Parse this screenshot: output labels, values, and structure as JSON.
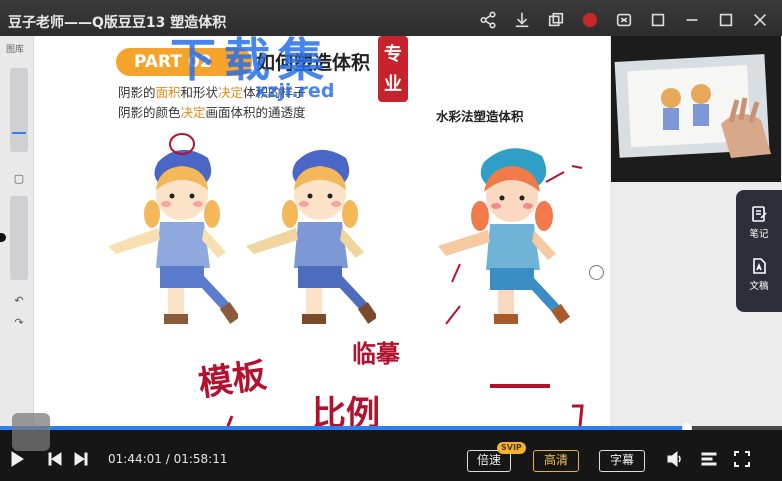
{
  "title_bar": {
    "title": "豆子老师——Q版豆豆13 塑造体积",
    "icons": [
      "share-icon",
      "download-icon",
      "layers-icon",
      "record-icon",
      "screen-icon",
      "pin-icon",
      "minimize-icon",
      "maximize-icon",
      "close-icon"
    ]
  },
  "canvas": {
    "rail_label": "图库",
    "part_badge": "PART 02",
    "heading": "如何塑造体积",
    "line1_a": "阴影的",
    "line1_b": "面积",
    "line1_c": "和形状",
    "line1_d": "决定",
    "line1_e": "体积的样子",
    "line2_a": "阴影的颜色",
    "line2_b": "决定",
    "line2_c": "画面体积的通透度",
    "sub_title": "水彩法塑造体积",
    "watermark": "下载集",
    "watermark_url": "xzji.red",
    "seal": "专业",
    "handwriting": [
      "模板",
      "临摹",
      "比例"
    ]
  },
  "side_panel": {
    "tools": [
      {
        "label": "笔记",
        "icon": "note-icon"
      },
      {
        "label": "文稿",
        "icon": "document-ai-icon"
      }
    ]
  },
  "player": {
    "progress": 0.878,
    "current_time": "01:44:01",
    "separator": " / ",
    "total_time": "01:58:11",
    "speed_label": "倍速",
    "speed_badge": "SVIP",
    "quality_label": "高清",
    "subtitle_label": "字幕",
    "accent": "#2e7ff0"
  }
}
